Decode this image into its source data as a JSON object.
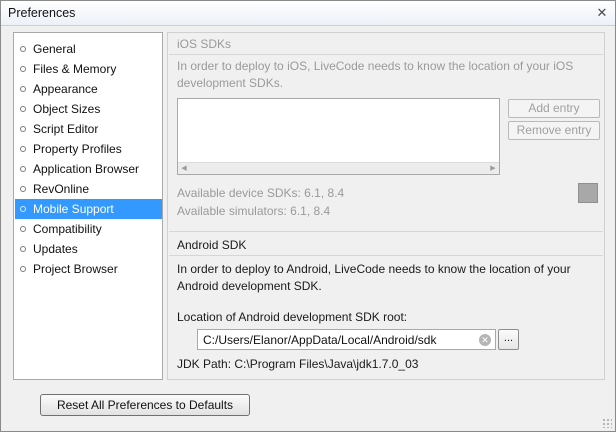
{
  "window": {
    "title": "Preferences",
    "close_glyph": "✕"
  },
  "sidebar": {
    "items": [
      {
        "label": "General"
      },
      {
        "label": "Files & Memory"
      },
      {
        "label": "Appearance"
      },
      {
        "label": "Object Sizes"
      },
      {
        "label": "Script Editor"
      },
      {
        "label": "Property Profiles"
      },
      {
        "label": "Application Browser"
      },
      {
        "label": "RevOnline"
      },
      {
        "label": "Mobile Support",
        "selected": true
      },
      {
        "label": "Compatibility"
      },
      {
        "label": "Updates"
      },
      {
        "label": "Project Browser"
      }
    ]
  },
  "ios": {
    "heading": "iOS SDKs",
    "description_line1": "In order to deploy to iOS, LiveCode needs to know the location of your iOS",
    "description_line2": "development SDKs.",
    "add_entry_label": "Add entry",
    "remove_entry_label": "Remove entry",
    "scroll_left_glyph": "◀",
    "scroll_right_glyph": "▶",
    "device_sdks": "Available device SDKs: 6.1, 8.4",
    "simulators": "Available simulators: 6.1, 8.4",
    "swatch_color": "#a8a8a8"
  },
  "android": {
    "heading": "Android SDK",
    "description_line1": "In order to deploy to Android, LiveCode needs to know the location of your",
    "description_line2": "Android development SDK.",
    "sdk_root_label": "Location of Android development SDK root:",
    "sdk_root_value": "C:/Users/Elanor/AppData/Local/Android/sdk",
    "clear_glyph": "✕",
    "browse_label": "...",
    "jdk_path": "JDK Path: C:\\Program Files\\Java\\jdk1.7.0_03"
  },
  "footer": {
    "reset_label": "Reset All Preferences to Defaults"
  },
  "colors": {
    "selection": "#3399ff",
    "disabled_text": "#9a9a9a"
  }
}
